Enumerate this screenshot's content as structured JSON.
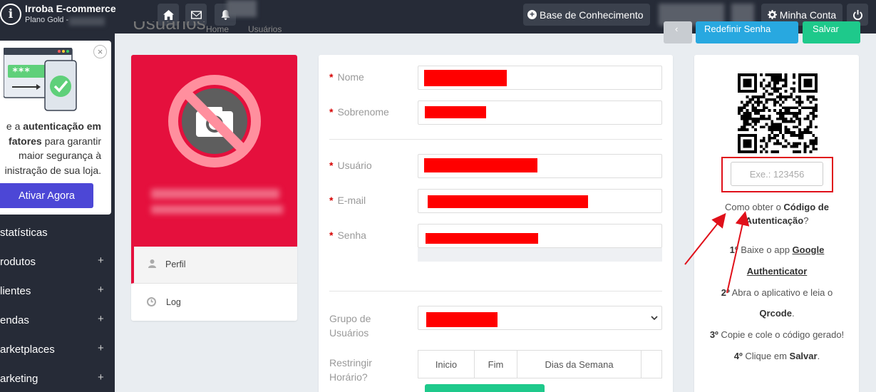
{
  "header": {
    "brand_name": "Irroba E-commerce",
    "plan": "Plano Gold -",
    "knowledge_base": "Base de Conhecimento",
    "account": "Minha Conta"
  },
  "page": {
    "title": "Usuários",
    "breadcrumb_home": "Home",
    "breadcrumb_current": "Usuários",
    "reset_password": "Redefinir Senha",
    "save": "Salvar"
  },
  "promo": {
    "line1_pre": "e a ",
    "line1_bold": "autenticação em",
    "line2_bold": "fatores",
    "line2_post": " para garantir",
    "line3": "maior segurança à",
    "line4": "inistração de sua loja.",
    "button": "Ativar Agora",
    "close": "×"
  },
  "sidebar": {
    "items": [
      {
        "label": "statísticas",
        "expandable": false
      },
      {
        "label": "rodutos",
        "expandable": true
      },
      {
        "label": "lientes",
        "expandable": true
      },
      {
        "label": "endas",
        "expandable": true
      },
      {
        "label": "arketplaces",
        "expandable": true
      },
      {
        "label": "arketing",
        "expandable": true
      }
    ]
  },
  "profile": {
    "nav": [
      {
        "label": "Perfil",
        "icon": "user-icon",
        "active": true
      },
      {
        "label": "Log",
        "icon": "clock-icon",
        "active": false
      }
    ]
  },
  "form": {
    "nome": "Nome",
    "sobrenome": "Sobrenome",
    "usuario": "Usuário",
    "email": "E-mail",
    "senha": "Senha",
    "grupo_line1": "Grupo de",
    "grupo_line2": "Usuários",
    "restringir_line1": "Restringir",
    "restringir_line2": "Horário?",
    "table_headers": [
      "Inicio",
      "Fim",
      "Dias da Semana",
      ""
    ]
  },
  "twofa": {
    "placeholder": "Exe.: 123456",
    "how_pre": "Como obter o ",
    "how_bold1": "Código de",
    "how_bold2": "Autenticação",
    "how_post": "?",
    "step1_num": "1º",
    "step1_text": " Baixe o app ",
    "step1_link1": "Google",
    "step1_link2": "Authenticator",
    "step2_num": "2º",
    "step2_text": " Abra o aplicativo e leia o",
    "step2_bold": "Qrcode",
    "step2_post": ".",
    "step3_num": "3º",
    "step3_text": " Copie e cole o código gerado!",
    "step4_num": "4º",
    "step4_text": " Clique em ",
    "step4_bold": "Salvar",
    "step4_post": "."
  },
  "colors": {
    "topbar": "#262b37",
    "profile_header": "#e5103d",
    "primary_button": "#4c47d6",
    "save_button": "#1ec98b",
    "reset_button": "#28a8e0",
    "required": "#d60000",
    "redaction": "#ff0000",
    "annotation": "#e0101a"
  }
}
